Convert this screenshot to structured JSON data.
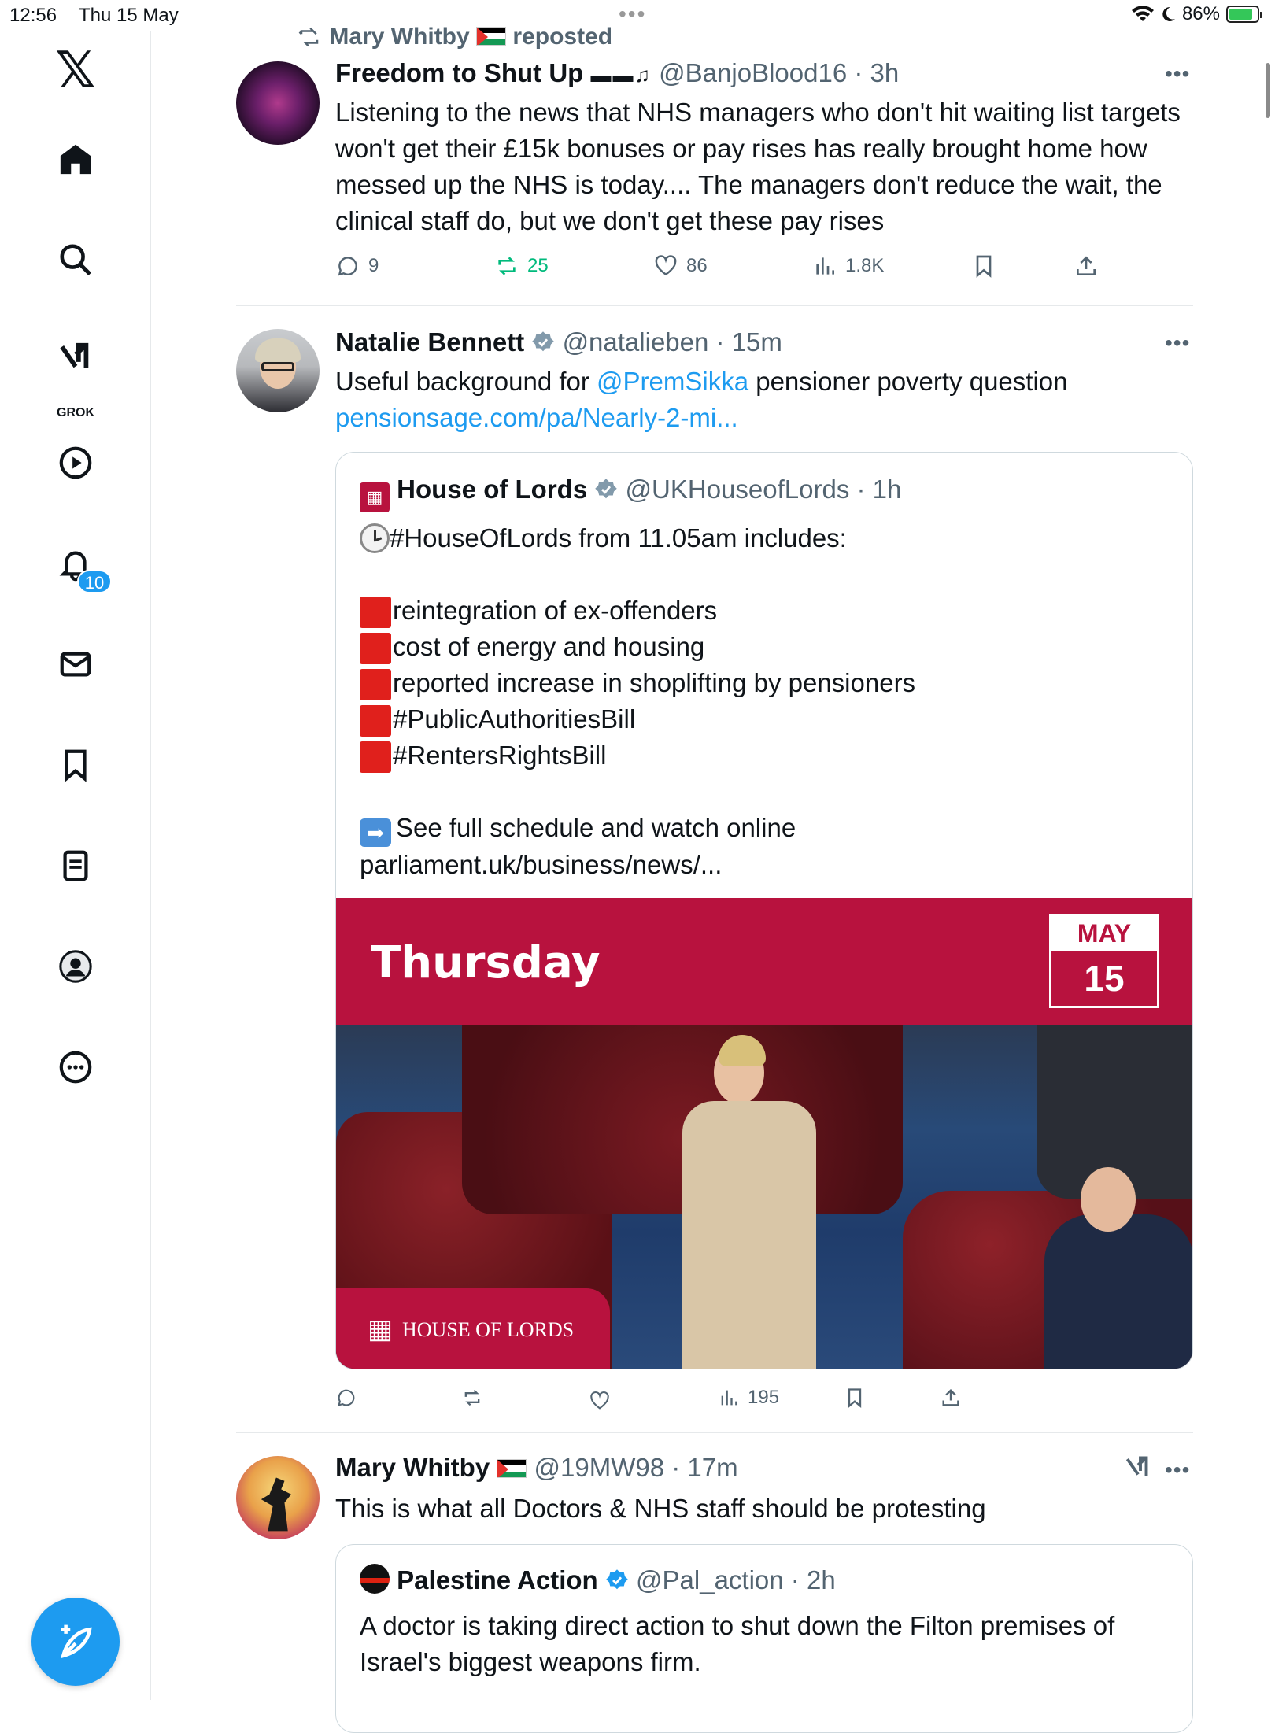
{
  "status": {
    "time": "12:56",
    "date": "Thu 15 May",
    "battery": "86%",
    "battery_level": 0.86
  },
  "sidebar": {
    "grok_label": "GROK",
    "notifications_badge": "10",
    "icons": [
      "x-logo",
      "home-icon",
      "search-icon",
      "grok-icon",
      "video-icon",
      "bell-icon",
      "mail-icon",
      "bookmark-icon",
      "list-icon",
      "profile-icon",
      "more-icon"
    ]
  },
  "post1": {
    "repost_by": "Mary Whitby",
    "repost_label": "reposted",
    "name": "Freedom to Shut Up",
    "handle": "@BanjoBlood16",
    "time": "3h",
    "text": "Listening to the news that NHS managers who don't hit waiting list targets won't get their £15k bonuses or pay rises has really brought home how messed up the NHS is today.... The managers don't reduce the wait, the clinical staff do, but we don't get these pay rises",
    "replies": "9",
    "reposts": "25",
    "likes": "86",
    "views": "1.8K"
  },
  "post2": {
    "name": "Natalie Bennett",
    "handle": "@natalieben",
    "time": "15m",
    "text_pre": "Useful background for ",
    "mention": "@PremSikka",
    "text_post": " pensioner poverty question",
    "link": "pensionsage.com/pa/Nearly-2-mi...",
    "quote": {
      "name": "House of Lords",
      "handle": "@UKHouseofLords",
      "time": "1h",
      "intro": "#HouseOfLords from 11.05am includes:",
      "items": [
        "reintegration of ex-offenders",
        "cost of energy and housing",
        "reported increase in shoplifting by pensioners",
        "#PublicAuthoritiesBill",
        "#RentersRightsBill"
      ],
      "cta": "See full schedule and watch online",
      "url": "parliament.uk/business/news/...",
      "banner_day": "Thursday",
      "banner_month": "MAY",
      "banner_date": "15",
      "logo_text": "HOUSE OF LORDS"
    },
    "views": "195"
  },
  "post3": {
    "name": "Mary Whitby",
    "handle": "@19MW98",
    "time": "17m",
    "text": "This is what all Doctors & NHS staff should be protesting",
    "quote": {
      "name": "Palestine Action",
      "handle": "@Pal_action",
      "time": "2h",
      "text": "A doctor is taking direct action to shut down the Filton premises of Israel's biggest weapons firm."
    }
  },
  "colors": {
    "accent": "#1d9bf0",
    "repost_green": "#00ba7c",
    "lords_red": "#b8123e"
  }
}
